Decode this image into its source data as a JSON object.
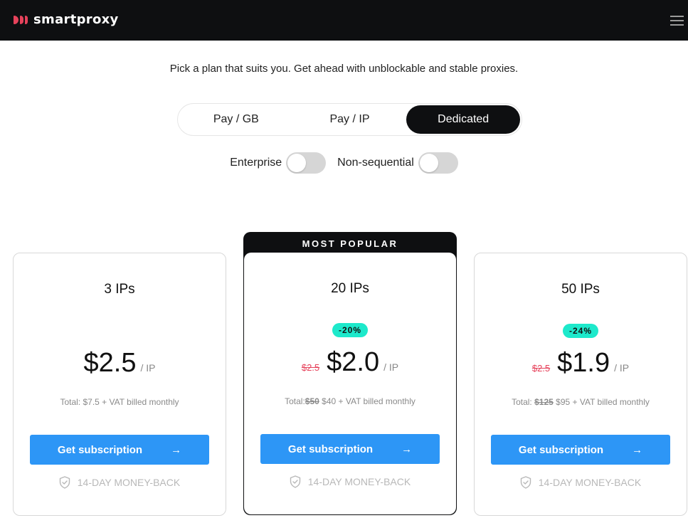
{
  "header": {
    "brand": "smartproxy",
    "logo_icon": "smartproxy-logo-icon",
    "menu_icon": "hamburger-menu-icon"
  },
  "subtitle": "Pick a plan that suits you. Get ahead with unblockable and stable proxies.",
  "plan_tabs": [
    {
      "label": "Pay / GB",
      "active": false
    },
    {
      "label": "Pay / IP",
      "active": false
    },
    {
      "label": "Dedicated",
      "active": true
    }
  ],
  "toggles": [
    {
      "label": "Enterprise",
      "on": false
    },
    {
      "label": "Non-sequential",
      "on": false
    }
  ],
  "colors": {
    "accent": "#2d96f6",
    "discount_badge": "#1de9cb",
    "old_price": "#e6425b",
    "dark": "#0e0f11"
  },
  "plans": [
    {
      "title": "3 IPs",
      "badge": null,
      "old_price": null,
      "price": "$2.5",
      "unit": "/ IP",
      "total_prefix": "Total:",
      "total_old": null,
      "total_rest": "$7.5 + VAT billed monthly",
      "cta": "Get subscription",
      "cta_icon": "arrow-right-icon",
      "guarantee": "14-DAY MONEY-BACK",
      "guarantee_icon": "shield-check-icon"
    },
    {
      "title": "20 IPs",
      "ribbon": "MOST POPULAR",
      "badge": "-20%",
      "old_price": "$2.5",
      "price": "$2.0",
      "unit": "/ IP",
      "total_prefix": "Total:",
      "total_old": "$50",
      "total_rest": "$40 + VAT billed monthly",
      "cta": "Get subscription",
      "cta_icon": "arrow-right-icon",
      "guarantee": "14-DAY MONEY-BACK",
      "guarantee_icon": "shield-check-icon"
    },
    {
      "title": "50 IPs",
      "badge": "-24%",
      "old_price": "$2.5",
      "price": "$1.9",
      "unit": "/ IP",
      "total_prefix": "Total:",
      "total_old": "$125",
      "total_rest": "$95 + VAT billed monthly",
      "cta": "Get subscription",
      "cta_icon": "arrow-right-icon",
      "guarantee": "14-DAY MONEY-BACK",
      "guarantee_icon": "shield-check-icon"
    }
  ]
}
